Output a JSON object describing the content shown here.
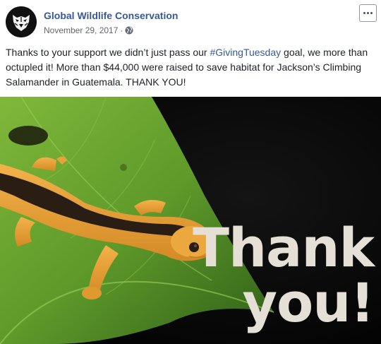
{
  "post": {
    "page_name": "Global Wildlife Conservation",
    "date": "November 29, 2017",
    "separator": "·",
    "audience_icon": "globe-icon",
    "more_icon": "ellipsis-icon",
    "text_before": "Thanks to your support we didn’t just pass our ",
    "hashtag": "#GivingTuesday",
    "text_after": " goal, we more than octupled it! More than $44,000 were raised to save habitat for Jackson’s Climbing Salamander in Guatemala. THANK YOU!",
    "image": {
      "overlay_line1": "Thank",
      "overlay_line2": "you!",
      "subject": "salamander-on-leaf"
    }
  },
  "colors": {
    "link": "#365899",
    "meta": "#616770",
    "text": "#1d2129",
    "overlay_text": "#e6dfd6",
    "leaf": "#5f9a2a",
    "salamander": "#e8a23a",
    "stripe": "#2a1d14"
  }
}
